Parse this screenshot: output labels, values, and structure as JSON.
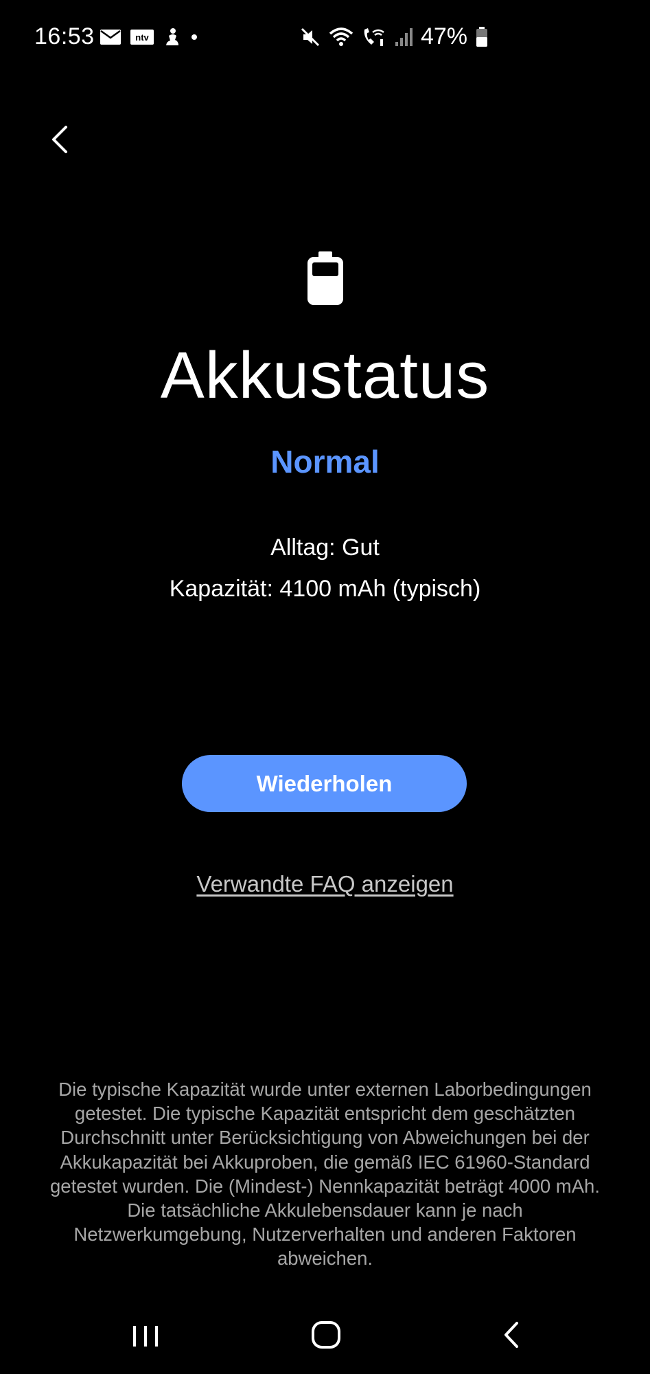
{
  "status_bar": {
    "time": "16:53",
    "left_icons": [
      "mail-icon",
      "ntv-icon",
      "figure-icon",
      "dot-icon"
    ],
    "right_icons": [
      "mute-icon",
      "wifi-icon",
      "wifi-call-icon",
      "signal-icon"
    ],
    "battery_percent": "47%"
  },
  "header": {
    "back_icon": "chevron-left-icon"
  },
  "main": {
    "hero_icon": "battery-icon",
    "title": "Akkustatus",
    "status": "Normal",
    "daily": "Alltag: Gut",
    "capacity": "Kapazität: 4100 mAh (typisch)",
    "retry_label": "Wiederholen",
    "faq_label": "Verwandte FAQ anzeigen",
    "disclaimer": "Die typische Kapazität wurde unter externen Laborbedingungen getestet. Die typische Kapazität entspricht dem geschätzten Durchschnitt unter Berücksichtigung von Abweichungen bei der Akkukapazität bei Akkuproben, die gemäß IEC 61960-Standard getestet wurden. Die (Mindest-) Nennkapazität beträgt 4000 mAh. Die tatsächliche Akkulebensdauer kann je nach Netzwerkumgebung, Nutzerverhalten und anderen Faktoren abweichen."
  },
  "nav_bar": {
    "icons": [
      "recents-icon",
      "home-icon",
      "back-icon"
    ]
  },
  "colors": {
    "background": "#000000",
    "accent": "#5b95ff",
    "text_primary": "#ffffff",
    "text_secondary": "#a6a6a6"
  }
}
